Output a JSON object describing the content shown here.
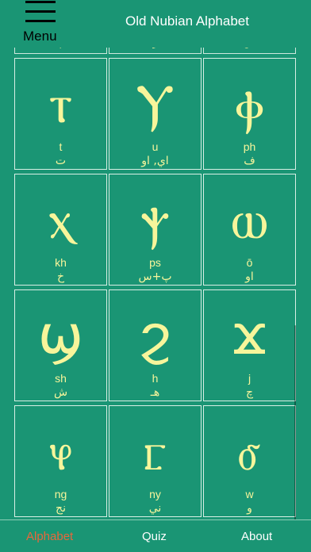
{
  "header": {
    "menu_label": "Menu",
    "title": "Old Nubian Alphabet"
  },
  "partial_row": [
    "پ",
    "ر",
    "س"
  ],
  "letters": [
    {
      "glyph": "ⲧ",
      "latin": "t",
      "arabic": "ت"
    },
    {
      "glyph": "Ⲩ",
      "latin": "u",
      "arabic": "اي, او"
    },
    {
      "glyph": "ⲫ",
      "latin": "ph",
      "arabic": "ف"
    },
    {
      "glyph": "ⲭ",
      "latin": "kh",
      "arabic": "خ"
    },
    {
      "glyph": "ⲯ",
      "latin": "ps",
      "arabic": "پ+س"
    },
    {
      "glyph": "ⲱ",
      "latin": "ō",
      "arabic": "او"
    },
    {
      "glyph": "ϣ",
      "latin": "sh",
      "arabic": "ش"
    },
    {
      "glyph": "ϩ",
      "latin": "h",
      "arabic": "هـ"
    },
    {
      "glyph": "ϫ",
      "latin": "j",
      "arabic": "چ"
    },
    {
      "glyph": "ⳡ",
      "latin": "ng",
      "arabic": "نج"
    },
    {
      "glyph": "ⳟ",
      "latin": "ny",
      "arabic": "ني"
    },
    {
      "glyph": "ⳝ",
      "latin": "w",
      "arabic": "و"
    }
  ],
  "tabs": [
    {
      "label": "Alphabet",
      "active": true
    },
    {
      "label": "Quiz",
      "active": false
    },
    {
      "label": "About",
      "active": false
    }
  ],
  "colors": {
    "background": "#1a9574",
    "glyph": "#f7f59b",
    "active_tab": "#e8673c",
    "inactive_tab": "#ffffff"
  }
}
